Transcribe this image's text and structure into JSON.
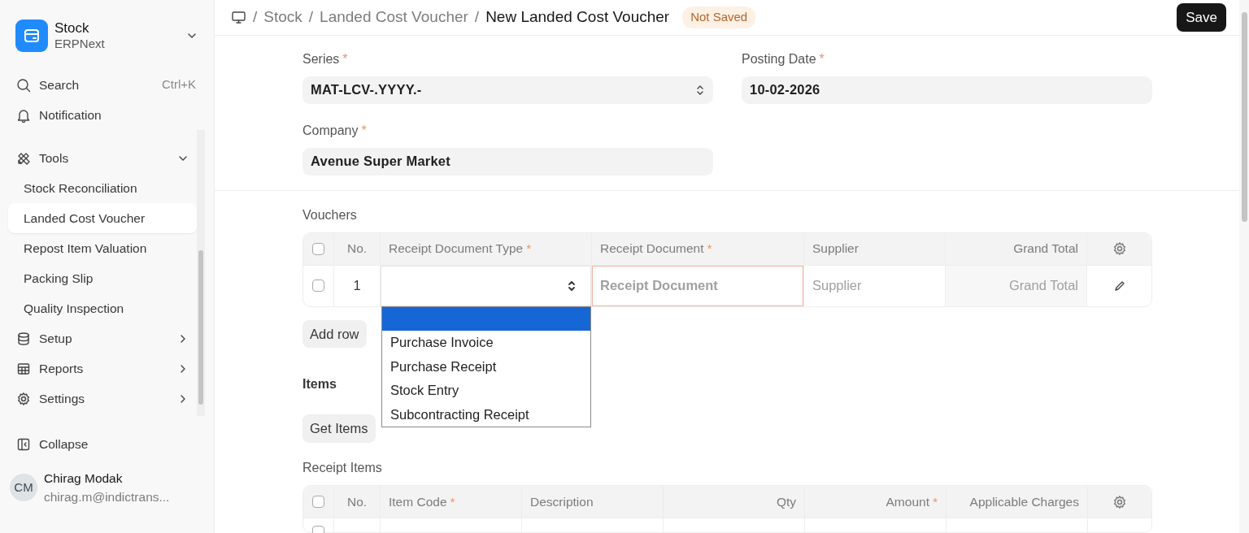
{
  "sidebar": {
    "app": {
      "title": "Stock",
      "subtitle": "ERPNext"
    },
    "search": {
      "label": "Search",
      "shortcut": "Ctrl+K"
    },
    "notification": {
      "label": "Notification"
    },
    "items": [
      {
        "label": "Tools",
        "kind": "group",
        "expanded": true,
        "children": [
          {
            "label": "Stock Reconciliation",
            "selected": false
          },
          {
            "label": "Landed Cost Voucher",
            "selected": true
          },
          {
            "label": "Repost Item Valuation",
            "selected": false
          },
          {
            "label": "Packing Slip",
            "selected": false
          },
          {
            "label": "Quality Inspection",
            "selected": false
          }
        ]
      },
      {
        "label": "Setup",
        "kind": "group",
        "expanded": false
      },
      {
        "label": "Reports",
        "kind": "group",
        "expanded": false
      },
      {
        "label": "Settings",
        "kind": "group",
        "expanded": false
      }
    ],
    "collapse": "Collapse",
    "user": {
      "initials": "CM",
      "name": "Chirag Modak",
      "email": "chirag.m@indictrans..."
    }
  },
  "breadcrumbs": [
    {
      "separator": "/",
      "label": "Stock"
    },
    {
      "separator": "/",
      "label": "Landed Cost Voucher"
    }
  ],
  "title_separator": "/",
  "title": "New Landed Cost Voucher",
  "status": "Not Saved",
  "save": "Save",
  "fields": [
    {
      "label": "Series",
      "mark": "*",
      "kind": "select",
      "value": "MAT-LCV-.YYYY.-"
    },
    {
      "label": "Posting Date",
      "mark": "*",
      "kind": "input",
      "value": "10-02-2026"
    },
    {
      "label": "Company",
      "mark": "*",
      "kind": "input",
      "value": "Avenue Super Market"
    }
  ],
  "vouchers": {
    "label": "Vouchers",
    "no_label": "No.",
    "all_checked": false,
    "columns": [
      {
        "label": "Receipt Document Type",
        "mark": "*"
      },
      {
        "label": "Receipt Document",
        "mark": "*"
      },
      {
        "label": "Supplier"
      },
      {
        "label": "Grand Total"
      }
    ],
    "rows": [
      {
        "no": "1",
        "checked": false,
        "cells": [
          {
            "kind": "select",
            "open": true,
            "options": [
              {
                "selected": true
              },
              {
                "label": "Purchase Invoice",
                "selected": false
              },
              {
                "label": "Purchase Receipt",
                "selected": false
              },
              {
                "label": "Stock Entry",
                "selected": false
              },
              {
                "label": "Subcontracting Receipt",
                "selected": false
              }
            ]
          },
          {
            "kind": "input",
            "placeholder": "Receipt Document",
            "invalid": true
          },
          {
            "kind": "input",
            "placeholder": "Supplier",
            "invalid": false
          },
          {
            "kind": "readonly",
            "placeholder": "Grand Total"
          }
        ]
      }
    ],
    "add_row": "Add row"
  },
  "items_section": {
    "label": "Items",
    "button": "Get Items"
  },
  "receipt_items": {
    "label": "Receipt Items",
    "no_label": "No.",
    "all_checked": false,
    "columns": [
      {
        "label": "Item Code",
        "mark": "*"
      },
      {
        "label": "Description"
      },
      {
        "label": "Qty"
      },
      {
        "label": "Amount",
        "mark": "*"
      },
      {
        "label": "Applicable Charges"
      }
    ],
    "rows": [
      {
        "checked": false
      }
    ]
  }
}
